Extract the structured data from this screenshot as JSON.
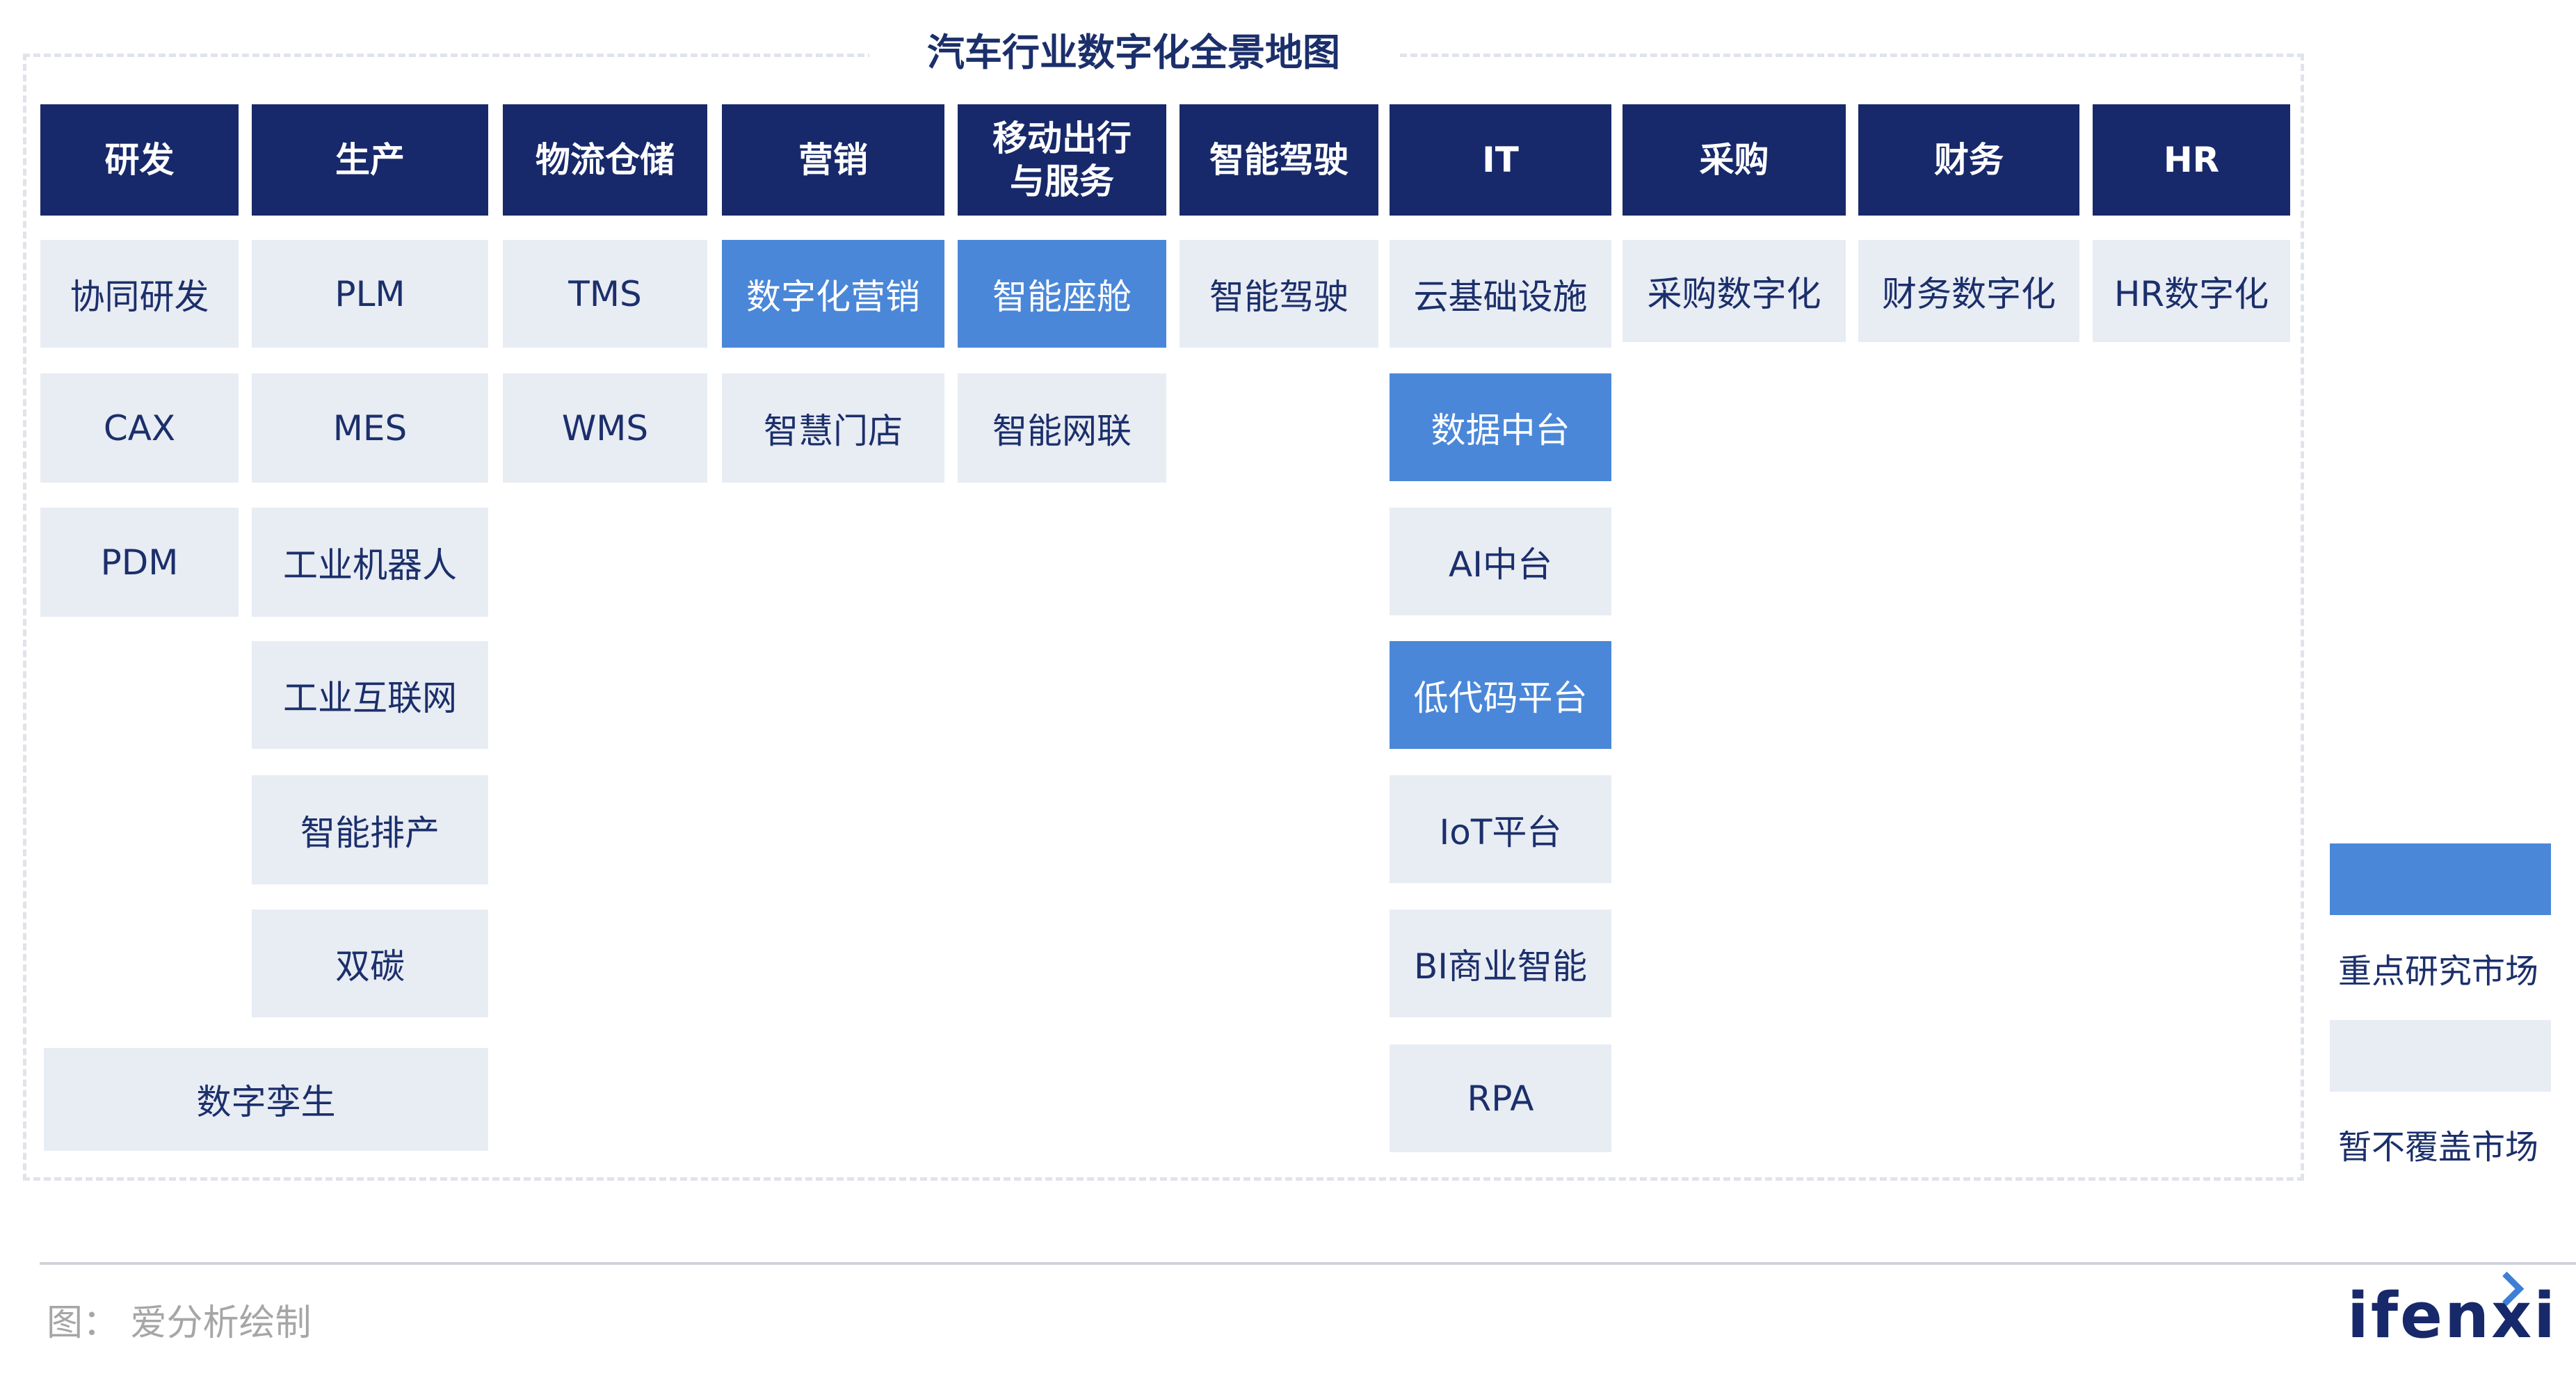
{
  "title": "汽车行业数字化全景地图",
  "columns": [
    {
      "id": "rd",
      "header": "研发",
      "items": [
        {
          "label": "协同研发",
          "highlight": false
        },
        {
          "label": "CAX",
          "highlight": false
        },
        {
          "label": "PDM",
          "highlight": false
        }
      ]
    },
    {
      "id": "production",
      "header": "生产",
      "items": [
        {
          "label": "PLM",
          "highlight": false
        },
        {
          "label": "MES",
          "highlight": false
        },
        {
          "label": "工业机器人",
          "highlight": false
        },
        {
          "label": "工业互联网",
          "highlight": false
        },
        {
          "label": "智能排产",
          "highlight": false
        },
        {
          "label": "双碳",
          "highlight": false
        }
      ]
    },
    {
      "id": "logistics",
      "header": "物流仓储",
      "items": [
        {
          "label": "TMS",
          "highlight": false
        },
        {
          "label": "WMS",
          "highlight": false
        }
      ]
    },
    {
      "id": "marketing",
      "header": "营销",
      "items": [
        {
          "label": "数字化营销",
          "highlight": true
        },
        {
          "label": "智慧门店",
          "highlight": false
        }
      ]
    },
    {
      "id": "mobility",
      "header": "移动出行\n与服务",
      "items": [
        {
          "label": "智能座舱",
          "highlight": true
        },
        {
          "label": "智能网联",
          "highlight": false
        }
      ]
    },
    {
      "id": "driving",
      "header": "智能驾驶",
      "items": [
        {
          "label": "智能驾驶",
          "highlight": false
        }
      ]
    },
    {
      "id": "it",
      "header": "IT",
      "items": [
        {
          "label": "云基础设施",
          "highlight": false
        },
        {
          "label": "数据中台",
          "highlight": true
        },
        {
          "label": "AI中台",
          "highlight": false
        },
        {
          "label": "低代码平台",
          "highlight": true
        },
        {
          "label": "IoT平台",
          "highlight": false
        },
        {
          "label": "BI商业智能",
          "highlight": false
        },
        {
          "label": "RPA",
          "highlight": false
        }
      ]
    },
    {
      "id": "procurement",
      "header": "采购",
      "items": [
        {
          "label": "采购数字化",
          "highlight": false
        }
      ]
    },
    {
      "id": "finance",
      "header": "财务",
      "items": [
        {
          "label": "财务数字化",
          "highlight": false
        }
      ]
    },
    {
      "id": "hr",
      "header": "HR",
      "items": [
        {
          "label": "HR数字化",
          "highlight": false
        }
      ]
    }
  ],
  "spanning_item": {
    "label": "数字孪生",
    "highlight": false
  },
  "legend": [
    {
      "label": "重点研究市场",
      "color": "#4a87d8"
    },
    {
      "label": "暂不覆盖市场",
      "color": "#e8ecf3"
    }
  ],
  "source": "图：  爱分析绘制",
  "logo": "ifenxi",
  "colors": {
    "header_bg": "#17296a",
    "highlight_bg": "#4a87d8",
    "default_bg": "#e8ecf3",
    "text_dark": "#1b2f6b"
  }
}
